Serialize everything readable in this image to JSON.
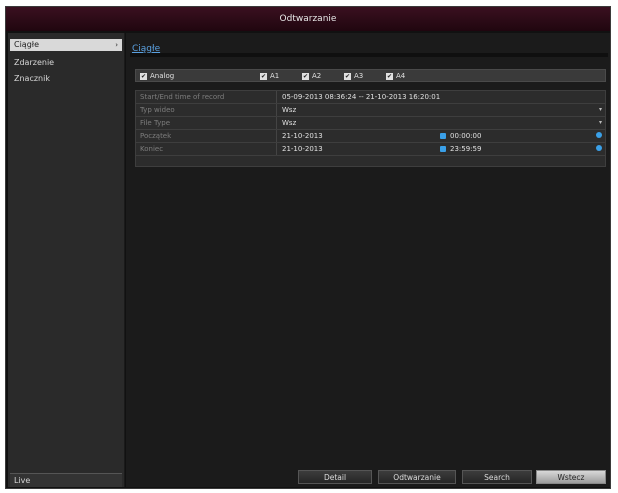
{
  "window": {
    "title": "Odtwarzanie"
  },
  "sidebar": {
    "items": [
      {
        "label": "Ciągłe",
        "active": true,
        "arrow": "›"
      },
      {
        "label": "Zdarzenie",
        "active": false
      },
      {
        "label": "Znacznik",
        "active": false
      }
    ],
    "live_label": "Live"
  },
  "main": {
    "section_label": "Ciągłe",
    "checkboxes": [
      {
        "label": "Analog",
        "checked": true
      },
      {
        "label": "A1",
        "checked": true
      },
      {
        "label": "A2",
        "checked": true
      },
      {
        "label": "A3",
        "checked": true
      },
      {
        "label": "A4",
        "checked": true
      }
    ],
    "rows": [
      {
        "label": "Start/End time of record",
        "value": "05-09-2013 08:36:24  --  21-10-2013 16:20:01"
      },
      {
        "label": "Typ wideo",
        "value": "Wsz"
      },
      {
        "label": "File Type",
        "value": "Wsz"
      },
      {
        "label": "Początek",
        "value": "21-10-2013",
        "time": "00:00:00"
      },
      {
        "label": "Koniec",
        "value": "21-10-2013",
        "time": "23:59:59"
      }
    ],
    "buttons": {
      "detail": "Detail",
      "playback": "Odtwarzanie",
      "search": "Search",
      "back": "Wstecz"
    }
  },
  "colors": {
    "accent": "#3aa0e8",
    "title_bar": "#2a0a18"
  }
}
